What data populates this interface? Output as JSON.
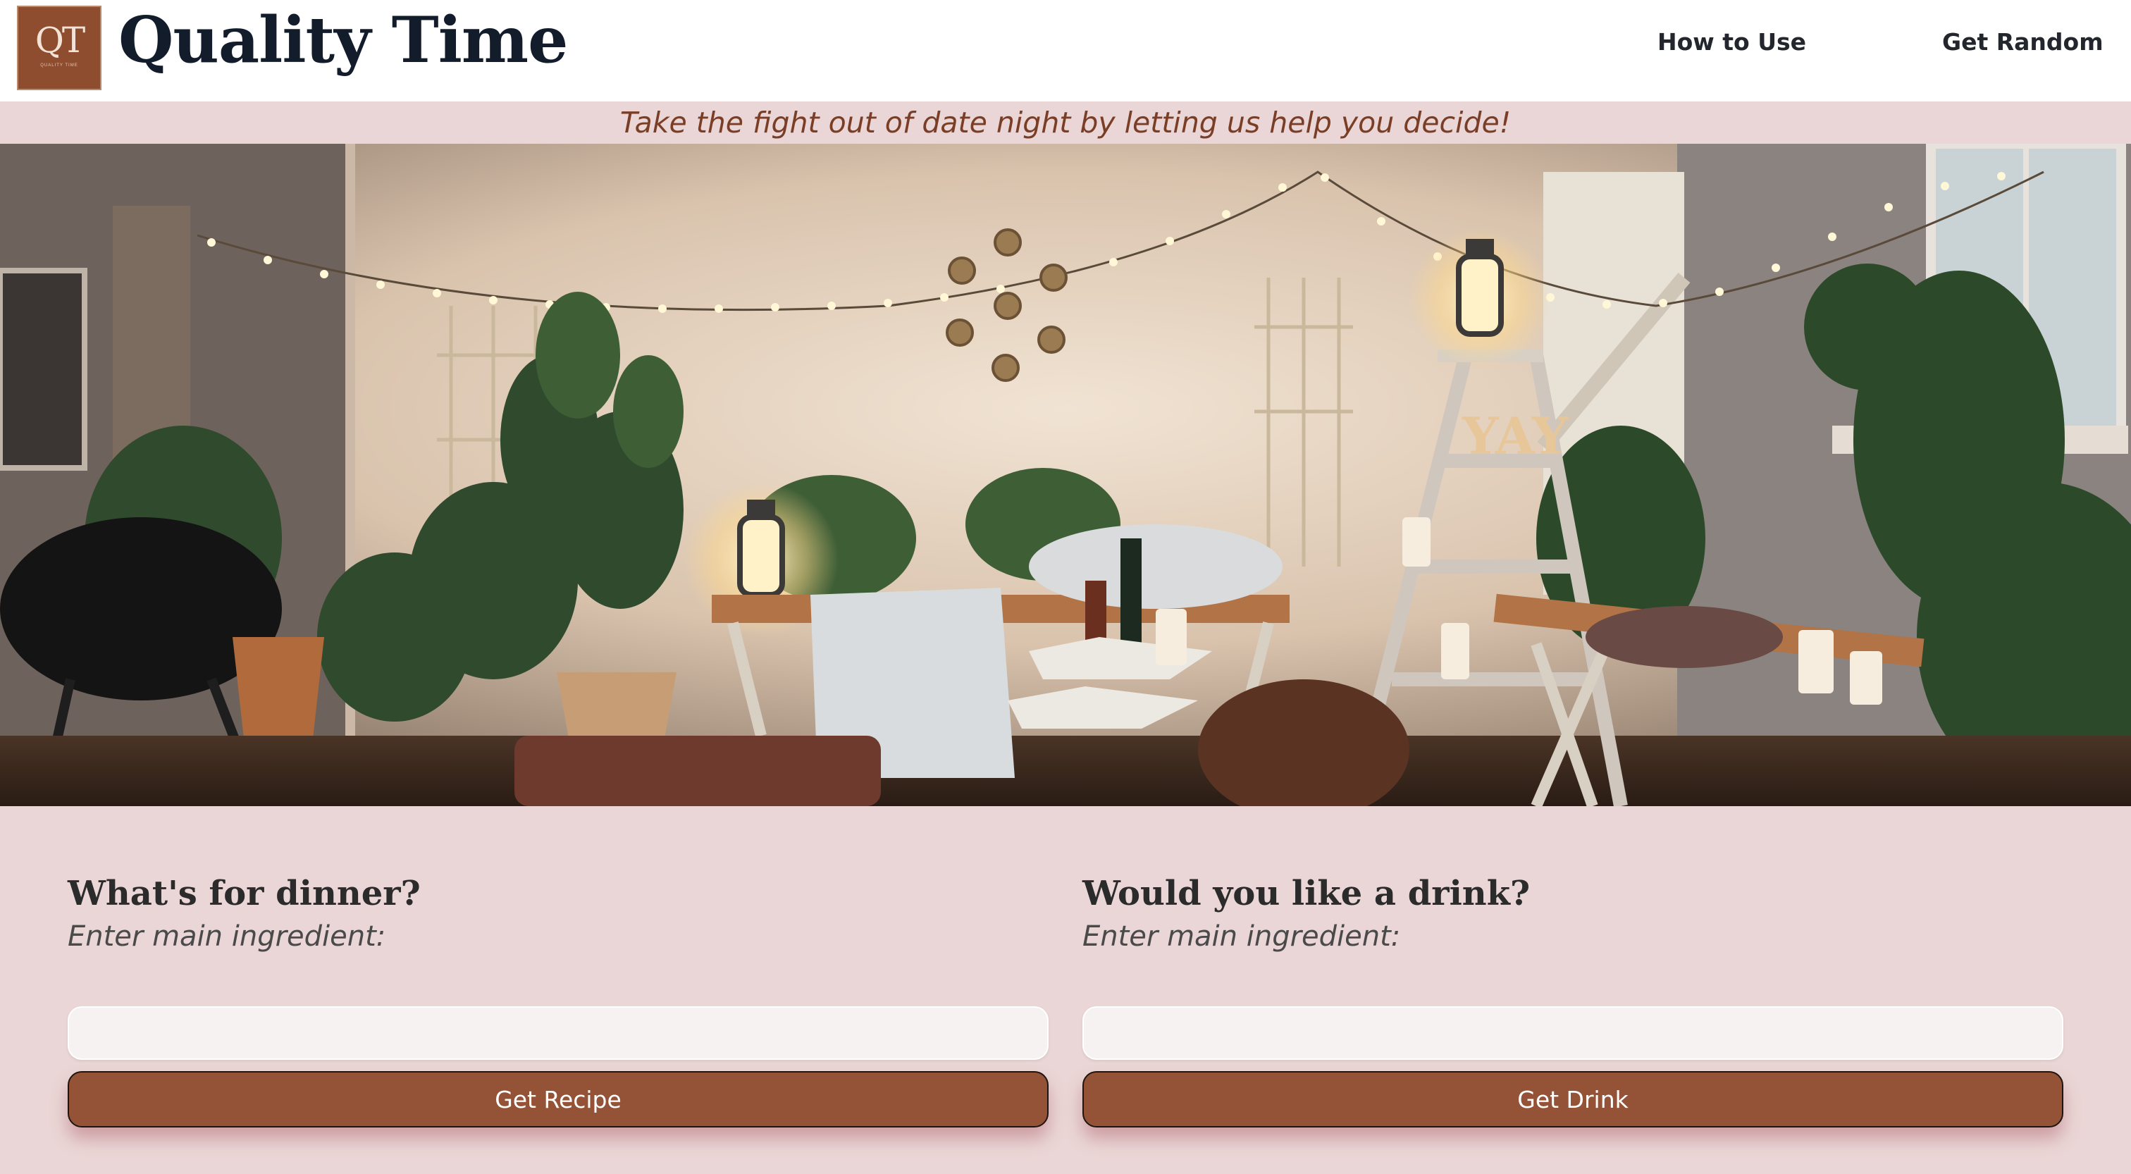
{
  "header": {
    "logo_text": "QT",
    "logo_subtext": "QUALITY TIME",
    "title": "Quality Time",
    "nav": [
      {
        "label": "How to Use"
      },
      {
        "label": "Get Random"
      }
    ]
  },
  "tagline": "Take the fight out of date night by letting us help you decide!",
  "hero": {
    "marquee_text": "YAY"
  },
  "dinner": {
    "heading": "What's for dinner?",
    "hint": "Enter main ingredient:",
    "input_value": "",
    "button_label": "Get Recipe"
  },
  "drink": {
    "heading": "Would you like a drink?",
    "hint": "Enter main ingredient:",
    "input_value": "",
    "button_label": "Get Drink"
  },
  "colors": {
    "accent_brown": "#945336",
    "page_background": "#ead6d6",
    "brand_dark": "#121c2b"
  }
}
